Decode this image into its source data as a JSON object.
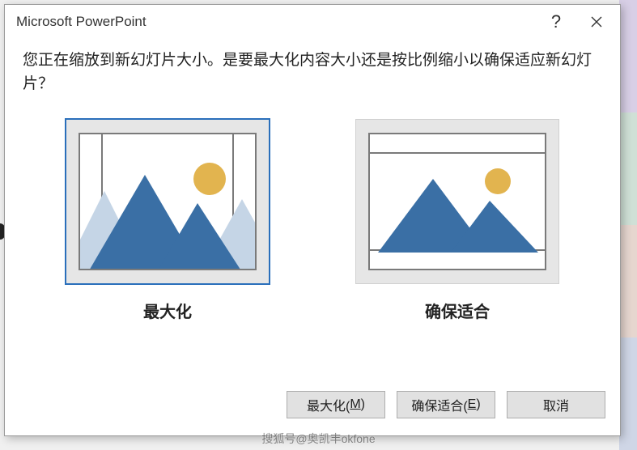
{
  "titlebar": {
    "title": "Microsoft PowerPoint",
    "help_icon": "help-icon",
    "close_icon": "close-icon"
  },
  "message": "您正在缩放到新幻灯片大小。是要最大化内容大小还是按比例缩小以确保适应新幻灯片？",
  "options": {
    "maximize": {
      "label": "最大化",
      "selected": true
    },
    "ensure_fit": {
      "label": "确保适合",
      "selected": false
    }
  },
  "buttons": {
    "maximize": {
      "text": "最大化(",
      "accel": "M",
      "tail": ")"
    },
    "ensure_fit": {
      "text": "确保适合(",
      "accel": "E",
      "tail": ")"
    },
    "cancel": {
      "label": "取消"
    }
  },
  "colors": {
    "accent": "#2a6fbb",
    "mountain_dark": "#3a6fa5",
    "mountain_light": "#c5d5e6",
    "sun": "#e2b44f"
  },
  "watermark": "搜狐号@奥凯丰okfone"
}
